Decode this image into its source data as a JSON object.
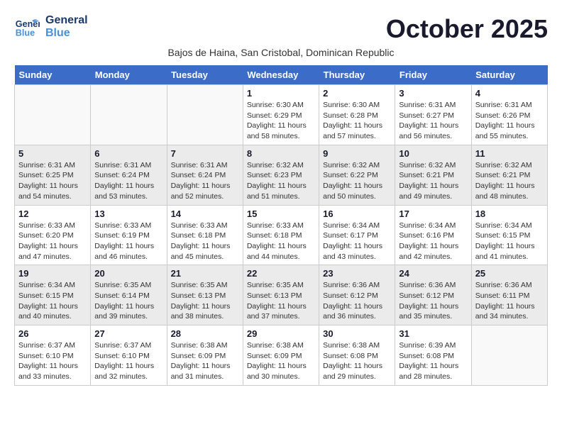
{
  "header": {
    "logo_line1": "General",
    "logo_line2": "Blue",
    "month_title": "October 2025",
    "subtitle": "Bajos de Haina, San Cristobal, Dominican Republic"
  },
  "weekdays": [
    "Sunday",
    "Monday",
    "Tuesday",
    "Wednesday",
    "Thursday",
    "Friday",
    "Saturday"
  ],
  "weeks": [
    [
      {
        "day": "",
        "info": ""
      },
      {
        "day": "",
        "info": ""
      },
      {
        "day": "",
        "info": ""
      },
      {
        "day": "1",
        "info": "Sunrise: 6:30 AM\nSunset: 6:29 PM\nDaylight: 11 hours\nand 58 minutes."
      },
      {
        "day": "2",
        "info": "Sunrise: 6:30 AM\nSunset: 6:28 PM\nDaylight: 11 hours\nand 57 minutes."
      },
      {
        "day": "3",
        "info": "Sunrise: 6:31 AM\nSunset: 6:27 PM\nDaylight: 11 hours\nand 56 minutes."
      },
      {
        "day": "4",
        "info": "Sunrise: 6:31 AM\nSunset: 6:26 PM\nDaylight: 11 hours\nand 55 minutes."
      }
    ],
    [
      {
        "day": "5",
        "info": "Sunrise: 6:31 AM\nSunset: 6:25 PM\nDaylight: 11 hours\nand 54 minutes."
      },
      {
        "day": "6",
        "info": "Sunrise: 6:31 AM\nSunset: 6:24 PM\nDaylight: 11 hours\nand 53 minutes."
      },
      {
        "day": "7",
        "info": "Sunrise: 6:31 AM\nSunset: 6:24 PM\nDaylight: 11 hours\nand 52 minutes."
      },
      {
        "day": "8",
        "info": "Sunrise: 6:32 AM\nSunset: 6:23 PM\nDaylight: 11 hours\nand 51 minutes."
      },
      {
        "day": "9",
        "info": "Sunrise: 6:32 AM\nSunset: 6:22 PM\nDaylight: 11 hours\nand 50 minutes."
      },
      {
        "day": "10",
        "info": "Sunrise: 6:32 AM\nSunset: 6:21 PM\nDaylight: 11 hours\nand 49 minutes."
      },
      {
        "day": "11",
        "info": "Sunrise: 6:32 AM\nSunset: 6:21 PM\nDaylight: 11 hours\nand 48 minutes."
      }
    ],
    [
      {
        "day": "12",
        "info": "Sunrise: 6:33 AM\nSunset: 6:20 PM\nDaylight: 11 hours\nand 47 minutes."
      },
      {
        "day": "13",
        "info": "Sunrise: 6:33 AM\nSunset: 6:19 PM\nDaylight: 11 hours\nand 46 minutes."
      },
      {
        "day": "14",
        "info": "Sunrise: 6:33 AM\nSunset: 6:18 PM\nDaylight: 11 hours\nand 45 minutes."
      },
      {
        "day": "15",
        "info": "Sunrise: 6:33 AM\nSunset: 6:18 PM\nDaylight: 11 hours\nand 44 minutes."
      },
      {
        "day": "16",
        "info": "Sunrise: 6:34 AM\nSunset: 6:17 PM\nDaylight: 11 hours\nand 43 minutes."
      },
      {
        "day": "17",
        "info": "Sunrise: 6:34 AM\nSunset: 6:16 PM\nDaylight: 11 hours\nand 42 minutes."
      },
      {
        "day": "18",
        "info": "Sunrise: 6:34 AM\nSunset: 6:15 PM\nDaylight: 11 hours\nand 41 minutes."
      }
    ],
    [
      {
        "day": "19",
        "info": "Sunrise: 6:34 AM\nSunset: 6:15 PM\nDaylight: 11 hours\nand 40 minutes."
      },
      {
        "day": "20",
        "info": "Sunrise: 6:35 AM\nSunset: 6:14 PM\nDaylight: 11 hours\nand 39 minutes."
      },
      {
        "day": "21",
        "info": "Sunrise: 6:35 AM\nSunset: 6:13 PM\nDaylight: 11 hours\nand 38 minutes."
      },
      {
        "day": "22",
        "info": "Sunrise: 6:35 AM\nSunset: 6:13 PM\nDaylight: 11 hours\nand 37 minutes."
      },
      {
        "day": "23",
        "info": "Sunrise: 6:36 AM\nSunset: 6:12 PM\nDaylight: 11 hours\nand 36 minutes."
      },
      {
        "day": "24",
        "info": "Sunrise: 6:36 AM\nSunset: 6:12 PM\nDaylight: 11 hours\nand 35 minutes."
      },
      {
        "day": "25",
        "info": "Sunrise: 6:36 AM\nSunset: 6:11 PM\nDaylight: 11 hours\nand 34 minutes."
      }
    ],
    [
      {
        "day": "26",
        "info": "Sunrise: 6:37 AM\nSunset: 6:10 PM\nDaylight: 11 hours\nand 33 minutes."
      },
      {
        "day": "27",
        "info": "Sunrise: 6:37 AM\nSunset: 6:10 PM\nDaylight: 11 hours\nand 32 minutes."
      },
      {
        "day": "28",
        "info": "Sunrise: 6:38 AM\nSunset: 6:09 PM\nDaylight: 11 hours\nand 31 minutes."
      },
      {
        "day": "29",
        "info": "Sunrise: 6:38 AM\nSunset: 6:09 PM\nDaylight: 11 hours\nand 30 minutes."
      },
      {
        "day": "30",
        "info": "Sunrise: 6:38 AM\nSunset: 6:08 PM\nDaylight: 11 hours\nand 29 minutes."
      },
      {
        "day": "31",
        "info": "Sunrise: 6:39 AM\nSunset: 6:08 PM\nDaylight: 11 hours\nand 28 minutes."
      },
      {
        "day": "",
        "info": ""
      }
    ]
  ]
}
